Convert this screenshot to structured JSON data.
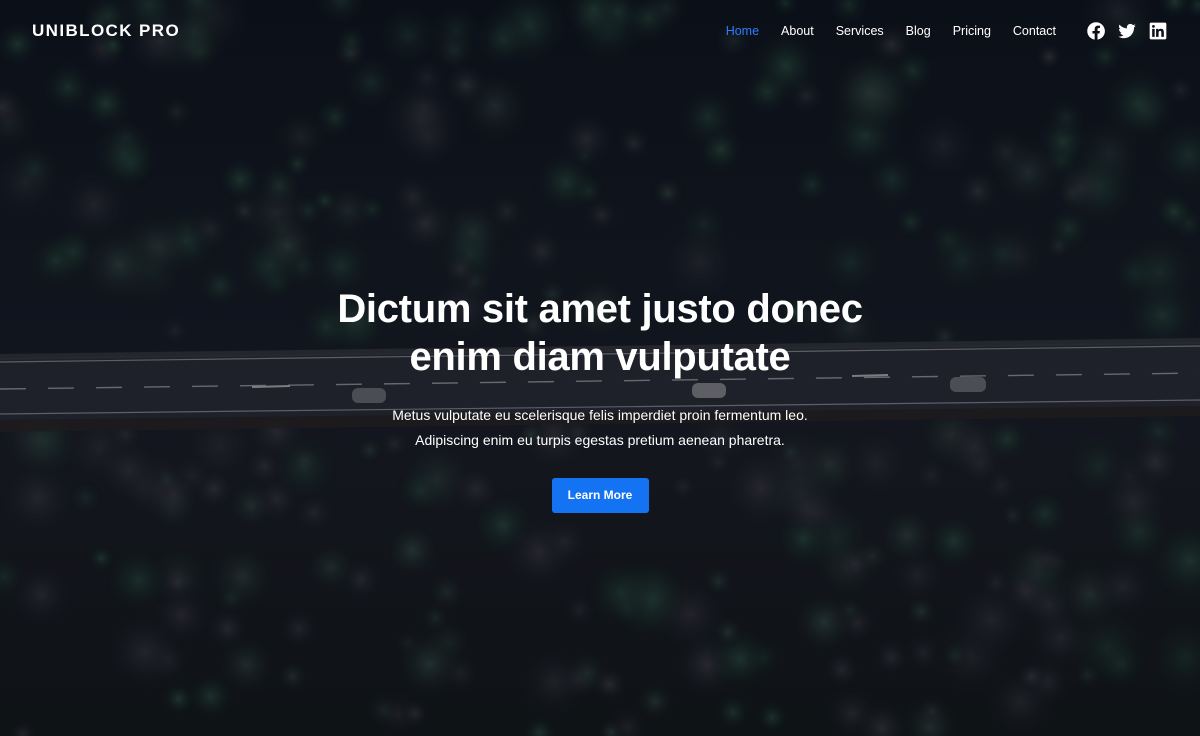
{
  "brand": {
    "name": "UNIBLOCK PRO"
  },
  "nav": {
    "items": [
      {
        "label": "Home",
        "active": true
      },
      {
        "label": "About",
        "active": false
      },
      {
        "label": "Services",
        "active": false
      },
      {
        "label": "Blog",
        "active": false
      },
      {
        "label": "Pricing",
        "active": false
      },
      {
        "label": "Contact",
        "active": false
      }
    ],
    "social": [
      {
        "icon": "facebook-icon"
      },
      {
        "icon": "twitter-icon"
      },
      {
        "icon": "linkedin-icon"
      }
    ]
  },
  "hero": {
    "title_line1": "Dictum sit amet justo donec",
    "title_line2": "enim diam vulputate",
    "subtitle_line1": "Metus vulputate eu scelerisque felis imperdiet proin fermentum leo.",
    "subtitle_line2": "Adipiscing enim eu turpis egestas pretium aenean pharetra.",
    "cta_label": "Learn More",
    "background": "aerial-forest-road-photo"
  },
  "colors": {
    "accent": "#1473f3",
    "active_link": "#2f7dff",
    "text": "#ffffff"
  }
}
